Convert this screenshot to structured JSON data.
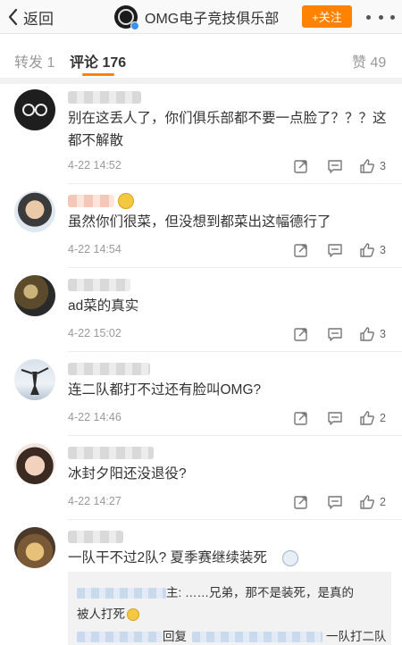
{
  "header": {
    "back_label": "返回",
    "title": "OMG电子竞技俱乐部",
    "follow_label": "+关注"
  },
  "tabs": [
    {
      "label": "转发 1",
      "active": false
    },
    {
      "label": "评论 176",
      "active": true
    },
    {
      "label": "赞 49",
      "active": false
    }
  ],
  "colors": {
    "accent": "#ff8200",
    "verified": "#3a91f0"
  },
  "comments": [
    {
      "text": "别在这丢人了，你们俱乐部都不要一点脸了？？？这都不解散",
      "time": "4-22 14:52",
      "likes": "3"
    },
    {
      "text": "虽然你们很菜，但没想到都菜出这幅德行了",
      "time": "4-22 14:54",
      "likes": "3"
    },
    {
      "text": "ad菜的真实",
      "time": "4-22 15:02",
      "likes": "3"
    },
    {
      "text": "连二队都打不过还有脸叫OMG?",
      "time": "4-22 14:46",
      "likes": "2"
    },
    {
      "text": "冰封夕阳还没退役?",
      "time": "4-22 14:27",
      "likes": "2"
    },
    {
      "text": "一队干不过2队? 夏季赛继续装死"
    }
  ],
  "reply": {
    "line1_suffix": "主: ……兄弟，那不是装死，是真的",
    "line2": "被人打死",
    "line3_middle": "回复",
    "line3_tail": "一队打二队"
  },
  "icons": [
    "chevron-left-icon",
    "more-dots-icon",
    "repost-icon",
    "comment-icon",
    "like-icon"
  ]
}
